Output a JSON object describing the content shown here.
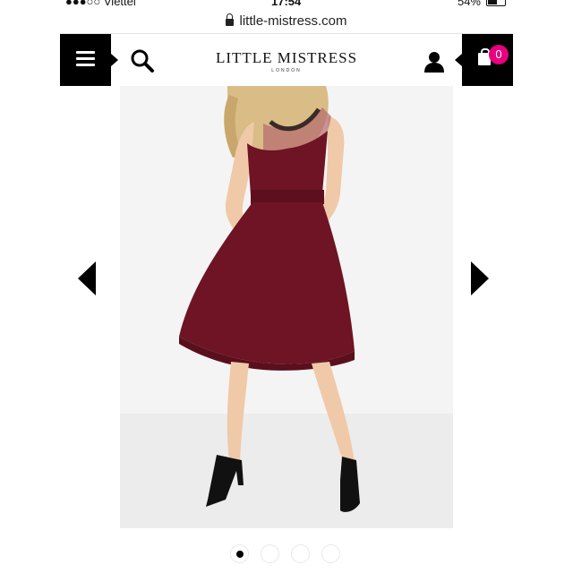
{
  "status_bar": {
    "carrier": "●●●○○ Viettel",
    "time": "17:54",
    "battery": "54%"
  },
  "browser": {
    "url": "little-mistress.com"
  },
  "header": {
    "logo_main": "LITTLE MISTRESS",
    "logo_sub": "LONDON",
    "cart_count": "0",
    "icons": [
      "hamburger-menu-icon",
      "search-icon",
      "user-icon",
      "shopping-bag-icon"
    ]
  },
  "gallery": {
    "slide_count": 4,
    "active_index": 0,
    "colors": {
      "dress": "#6e1424",
      "background": "#f4f4f4",
      "badge": "#e6007e"
    }
  }
}
